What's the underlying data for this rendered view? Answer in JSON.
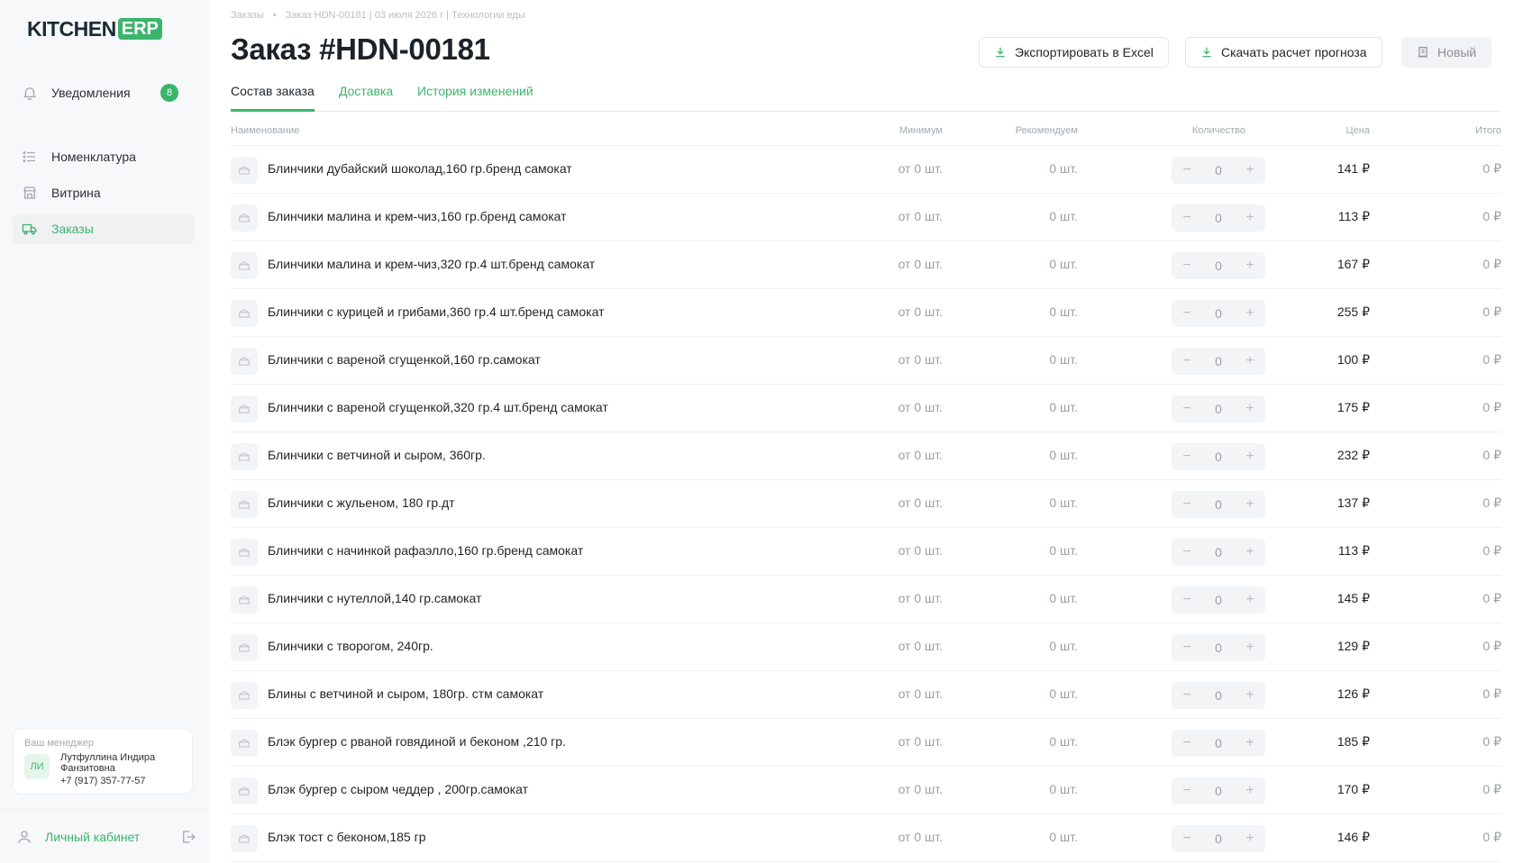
{
  "brand": {
    "name": "KITCHEN",
    "badge": "ERP"
  },
  "sidebar": {
    "notifications": {
      "label": "Уведомления",
      "count": "8"
    },
    "items": [
      {
        "label": "Номенклатура",
        "icon": "list-icon"
      },
      {
        "label": "Витрина",
        "icon": "storefront-icon"
      },
      {
        "label": "Заказы",
        "icon": "truck-icon",
        "active": true
      }
    ],
    "manager": {
      "caption": "Ваш менеджер",
      "initials": "ЛИ",
      "name": "Лутфуллина Индира Фанзитовна",
      "phone": "+7 (917) 357-77-57"
    },
    "cabinet": {
      "label": "Личный кабинет"
    }
  },
  "header": {
    "breadcrumb": [
      "Заказы",
      "Заказ HDN-00181 | 03 июля 2026 г | Технологии еды"
    ],
    "breadcrumb_sep": "•",
    "title": "Заказ #HDN-00181",
    "buttons": {
      "export": "Экспортировать в Excel",
      "forecast": "Скачать расчет прогноза",
      "status": "Новый"
    }
  },
  "tabs": [
    "Состав заказа",
    "Доставка",
    "История изменений"
  ],
  "table": {
    "columns": {
      "name": "Наименование",
      "min": "Минимум",
      "rec": "Рекомендуем",
      "qty": "Количество",
      "price": "Цена",
      "total": "Итого"
    },
    "rows": [
      {
        "name": "Блинчики дубайский шоколад,160 гр.бренд самокат",
        "min": "от 0 шт.",
        "rec": "0 шт.",
        "qty": "0",
        "price": "141 ₽",
        "total": "0 ₽"
      },
      {
        "name": "Блинчики малина и крем-чиз,160 гр.бренд самокат",
        "min": "от 0 шт.",
        "rec": "0 шт.",
        "qty": "0",
        "price": "113 ₽",
        "total": "0 ₽"
      },
      {
        "name": "Блинчики малина и крем-чиз,320 гр.4 шт.бренд самокат",
        "min": "от 0 шт.",
        "rec": "0 шт.",
        "qty": "0",
        "price": "167 ₽",
        "total": "0 ₽"
      },
      {
        "name": "Блинчики с курицей и грибами,360 гр.4 шт.бренд самокат",
        "min": "от 0 шт.",
        "rec": "0 шт.",
        "qty": "0",
        "price": "255 ₽",
        "total": "0 ₽"
      },
      {
        "name": "Блинчики с вареной сгущенкой,160 гр.самокат",
        "min": "от 0 шт.",
        "rec": "0 шт.",
        "qty": "0",
        "price": "100 ₽",
        "total": "0 ₽"
      },
      {
        "name": "Блинчики с вареной сгущенкой,320 гр.4 шт.бренд самокат",
        "min": "от 0 шт.",
        "rec": "0 шт.",
        "qty": "0",
        "price": "175 ₽",
        "total": "0 ₽"
      },
      {
        "name": "Блинчики с ветчиной и сыром, 360гр.",
        "min": "от 0 шт.",
        "rec": "0 шт.",
        "qty": "0",
        "price": "232 ₽",
        "total": "0 ₽"
      },
      {
        "name": "Блинчики с жульеном, 180 гр.дт",
        "min": "от 0 шт.",
        "rec": "0 шт.",
        "qty": "0",
        "price": "137 ₽",
        "total": "0 ₽"
      },
      {
        "name": "Блинчики с начинкой рафаэлло,160 гр.бренд самокат",
        "min": "от 0 шт.",
        "rec": "0 шт.",
        "qty": "0",
        "price": "113 ₽",
        "total": "0 ₽"
      },
      {
        "name": "Блинчики с нутеллой,140 гр.самокат",
        "min": "от 0 шт.",
        "rec": "0 шт.",
        "qty": "0",
        "price": "145 ₽",
        "total": "0 ₽"
      },
      {
        "name": "Блинчики с творогом, 240гр.",
        "min": "от 0 шт.",
        "rec": "0 шт.",
        "qty": "0",
        "price": "129 ₽",
        "total": "0 ₽"
      },
      {
        "name": "Блины с ветчиной и сыром, 180гр. стм самокат",
        "min": "от 0 шт.",
        "rec": "0 шт.",
        "qty": "0",
        "price": "126 ₽",
        "total": "0 ₽"
      },
      {
        "name": "Блэк бургер с рваной говядиной и беконом ,210 гр.",
        "min": "от 0 шт.",
        "rec": "0 шт.",
        "qty": "0",
        "price": "185 ₽",
        "total": "0 ₽"
      },
      {
        "name": "Блэк бургер с сыром чеддер , 200гр.самокат",
        "min": "от 0 шт.",
        "rec": "0 шт.",
        "qty": "0",
        "price": "170 ₽",
        "total": "0 ₽"
      },
      {
        "name": "Блэк тост с беконом,185 гр",
        "min": "от 0 шт.",
        "rec": "0 шт.",
        "qty": "0",
        "price": "146 ₽",
        "total": "0 ₽"
      }
    ]
  },
  "colors": {
    "accent": "#3bb56c",
    "muted": "#9aa0a8",
    "sidebar_bg": "#f7f8f9"
  }
}
